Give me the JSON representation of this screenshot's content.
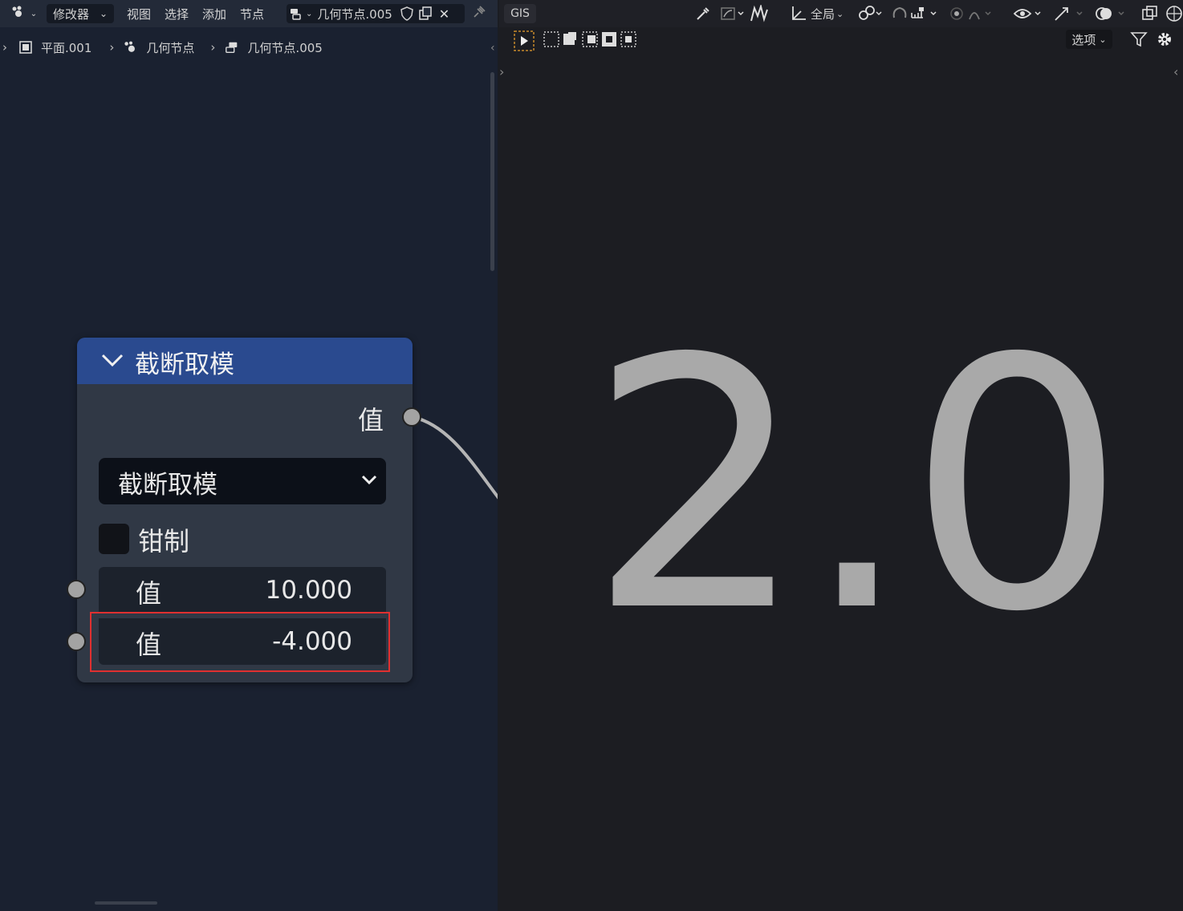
{
  "header": {
    "editor_type_icon": "node-editor-icon",
    "modifier_label": "修改器",
    "menus": [
      "视图",
      "选择",
      "添加",
      "节点"
    ],
    "node_group_name": "几何节点.005",
    "shield_icon": "fake-user-icon",
    "copy_icon": "duplicate-icon",
    "close_icon": "close-icon",
    "pin_icon": "pin-icon"
  },
  "breadcrumb": [
    "平面.001",
    "几何节点",
    "几何节点.005"
  ],
  "node": {
    "title": "截断取模",
    "output_label": "值",
    "operation": "截断取模",
    "clamp_label": "钳制",
    "inputs": [
      {
        "label": "值",
        "value": "10.000"
      },
      {
        "label": "值",
        "value": "-4.000"
      }
    ]
  },
  "viewer": {
    "gis_label": "GIS",
    "global_label": "全局",
    "options_label": "选项",
    "display_value": "2.0"
  },
  "colors": {
    "node_header": "#2a4a8f",
    "highlight": "#e03030"
  }
}
